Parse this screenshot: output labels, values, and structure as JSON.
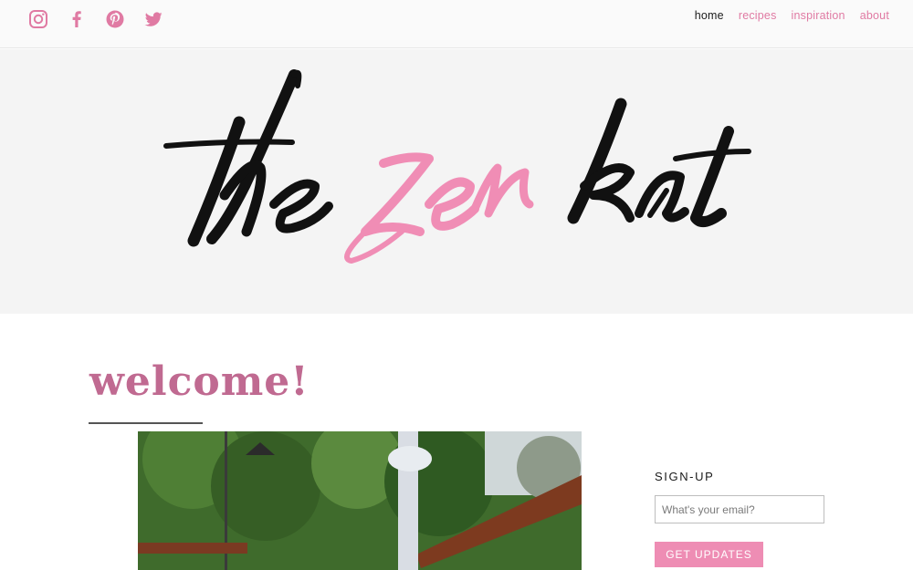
{
  "header": {
    "social": [
      {
        "icon": "instagram-icon"
      },
      {
        "icon": "facebook-icon"
      },
      {
        "icon": "pinterest-icon"
      },
      {
        "icon": "twitter-icon"
      }
    ],
    "nav": [
      {
        "label": "home",
        "active": true
      },
      {
        "label": "recipes",
        "active": false
      },
      {
        "label": "inspiration",
        "active": false
      },
      {
        "label": "about",
        "active": false
      }
    ]
  },
  "logo": {
    "word1": "the",
    "word2": "zen",
    "word3": "kat",
    "accent_color": "#f08db5",
    "text_color": "#111111"
  },
  "main": {
    "heading": "welcome!",
    "heading_color": "#c06a91"
  },
  "signup": {
    "title": "SIGN-UP",
    "email_placeholder": "What's your email?",
    "button_label": "GET UPDATES",
    "button_color": "#ee8db4"
  }
}
